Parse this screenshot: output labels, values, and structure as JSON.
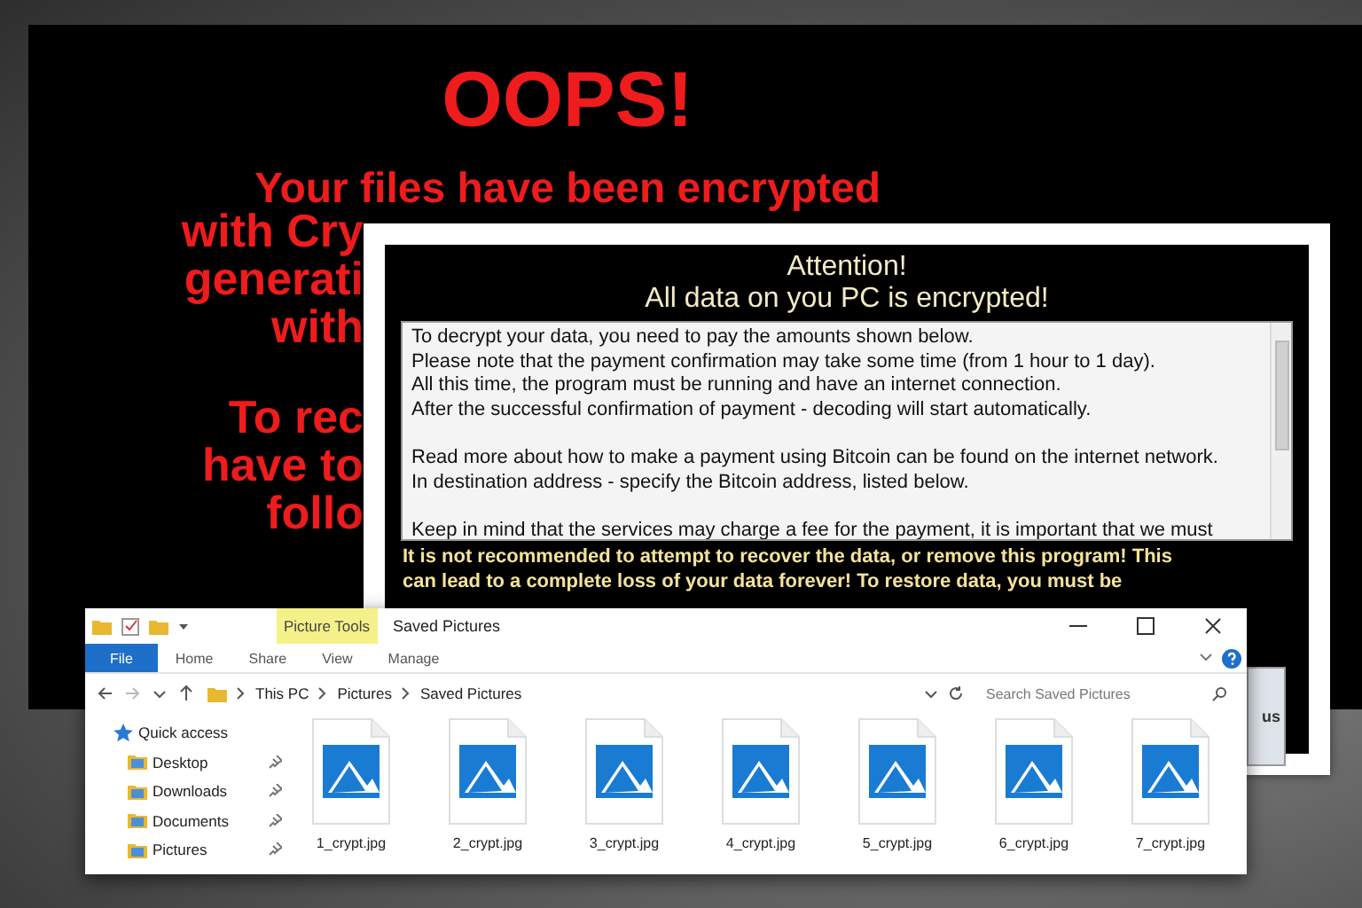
{
  "lock_screen": {
    "heading": "OOPS!",
    "lines": [
      "Your files have been encrypted"
    ],
    "partial_paragraphs": [
      [
        "with Cry",
        "generati",
        "with"
      ],
      [
        "To rec",
        "have to",
        "follo"
      ]
    ]
  },
  "ransom_note": {
    "title_lines": [
      "Attention!",
      "All data on you PC is encrypted!"
    ],
    "message": [
      [
        "To decrypt your data, you need to pay the amounts shown below.",
        "Please note that the payment confirmation may take some time (from 1 hour to 1 day).",
        "All this time, the program must be running and have an internet connection.",
        "After the successful confirmation of payment - decoding will start automatically."
      ],
      [
        "Read more about how to make a payment using Bitcoin can be found on the internet network.",
        "In destination address - specify the Bitcoin address, listed below."
      ],
      [
        "Keep in mind that the services may charge a fee for the payment, it is important that we must"
      ]
    ],
    "warning_lines": [
      "It is not recommended to attempt to recover the data, or remove this program! This",
      "can lead to a complete loss of your data forever! To restore data, you must be"
    ],
    "button_text": "us"
  },
  "explorer": {
    "context_tab": "Picture Tools",
    "title": "Saved Pictures",
    "ribbon_tabs": [
      {
        "label": "File",
        "kind": "file",
        "selected": false
      },
      {
        "label": "Home",
        "kind": "tab",
        "selected": false
      },
      {
        "label": "Share",
        "kind": "tab",
        "selected": false
      },
      {
        "label": "View",
        "kind": "tab",
        "selected": false
      },
      {
        "label": "Manage",
        "kind": "tab",
        "selected": false
      }
    ],
    "breadcrumbs": [
      "This PC",
      "Pictures",
      "Saved Pictures"
    ],
    "search": {
      "placeholder": "Search Saved Pictures"
    },
    "sidebar": [
      {
        "label": "Quick access",
        "kind": "header",
        "pinned": false
      },
      {
        "label": "Desktop",
        "kind": "folder",
        "pinned": true
      },
      {
        "label": "Downloads",
        "kind": "folder",
        "pinned": true
      },
      {
        "label": "Documents",
        "kind": "folder",
        "pinned": true
      },
      {
        "label": "Pictures",
        "kind": "folder",
        "pinned": true
      }
    ],
    "files": [
      "1_crypt.jpg",
      "2_crypt.jpg",
      "3_crypt.jpg",
      "4_crypt.jpg",
      "5_crypt.jpg",
      "6_crypt.jpg",
      "7_crypt.jpg"
    ]
  }
}
